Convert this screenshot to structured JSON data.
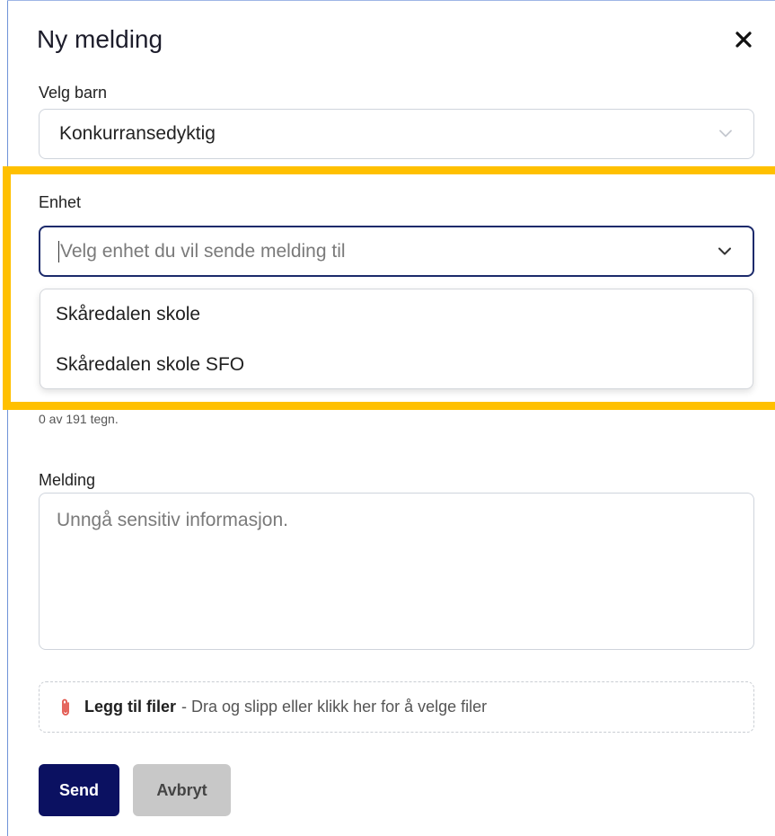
{
  "dialog": {
    "title": "Ny melding"
  },
  "child_select": {
    "label": "Velg barn",
    "value": "Konkurransedyktig"
  },
  "unit_select": {
    "label": "Enhet",
    "placeholder": "Velg enhet du vil sende melding til",
    "options": [
      {
        "label": "Skåredalen skole"
      },
      {
        "label": "Skåredalen skole SFO"
      }
    ]
  },
  "subject": {
    "counter": "0 av 191 tegn."
  },
  "message": {
    "label": "Melding",
    "placeholder": "Unngå sensitiv informasjon."
  },
  "attachments": {
    "strong": "Legg til filer",
    "text": "- Dra og slipp eller klikk her for å velge filer"
  },
  "actions": {
    "send": "Send",
    "cancel": "Avbryt"
  },
  "colors": {
    "primary": "#0b1161",
    "highlight": "#ffc000",
    "focus_border": "#1c2a6b",
    "paperclip": "#e2564d"
  },
  "icons": {
    "close": "close-icon",
    "chevron": "chevron-down-icon",
    "paperclip": "paperclip-icon"
  }
}
